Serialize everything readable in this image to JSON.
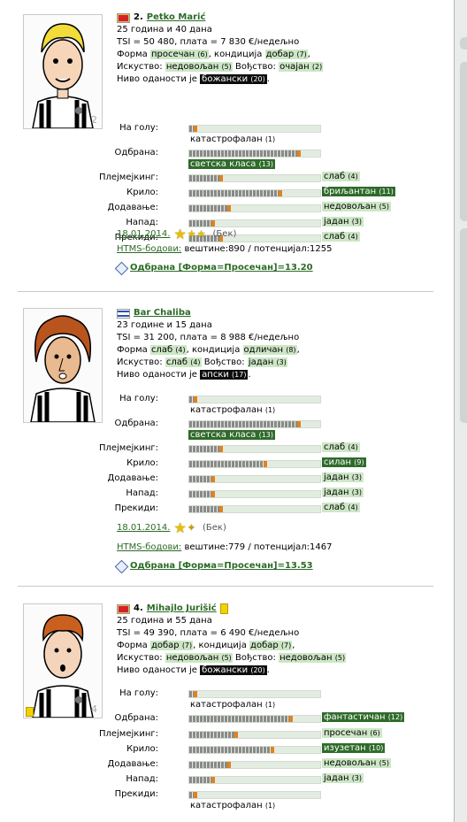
{
  "players": [
    {
      "number": "2.",
      "name": "Petko Marić",
      "age": "25 година и 40 дана",
      "tsi_line": "TSI = 50 480, плата = 7 830 €/недељно",
      "form_label": "Форма",
      "form_value": "просечан",
      "form_level": "(6)",
      "cond_label": ", кондиција",
      "cond_value": "добар",
      "cond_level": "(7)",
      "exp_label": "Искуство:",
      "exp_value": "недовољан",
      "exp_level": "(5)",
      "lead_label": "Вођство:",
      "lead_value": "очајан",
      "lead_level": "(2)",
      "loyal_label": "Ниво оданости је",
      "loyal_value": "божански",
      "loyal_level": "(20)",
      "shirt_number": "2",
      "skills": [
        {
          "label": "На голу:",
          "value": "катастрофалан",
          "level": "(1)",
          "pct": 0.06,
          "below": true
        },
        {
          "label": "Одбрана:",
          "value": "светска класа",
          "level": "(13)",
          "pct": 0.86,
          "below": true
        },
        {
          "label": "Плејмејкинг:",
          "value": "слаб",
          "level": "(4)",
          "pct": 0.26
        },
        {
          "label": "Крило:",
          "value": "бриљантан",
          "level": "(11)",
          "pct": 0.72
        },
        {
          "label": "Додавање:",
          "value": "недовољан",
          "level": "(5)",
          "pct": 0.32
        },
        {
          "label": "Напад:",
          "value": "јадан",
          "level": "(3)",
          "pct": 0.2
        },
        {
          "label": "Прекиди:",
          "value": "слаб",
          "level": "(4)",
          "pct": 0.26
        }
      ],
      "date": "18.01.2014.",
      "position": "(Бек)",
      "htms_label": "HTMS-бодови:",
      "htms_value": "вештине:890 / потенцијал:1255",
      "form_link": "Одбрана [Форма=Просечан]=13.20"
    },
    {
      "number": "",
      "name": "Bar Chaliba",
      "age": "23 године и 15 дана",
      "tsi_line": "TSI = 31 200, плата = 8 988 €/недељно",
      "form_label": "Форма",
      "form_value": "слаб",
      "form_level": "(4)",
      "cond_label": ", кондиција",
      "cond_value": "одличан",
      "cond_level": "(8)",
      "exp_label": "Искуство:",
      "exp_value": "слаб",
      "exp_level": "(4)",
      "lead_label": "Вођство:",
      "lead_value": "јадан",
      "lead_level": "(3)",
      "loyal_label": "Ниво оданости је",
      "loyal_value": "апски",
      "loyal_level": "(17)",
      "shirt_number": "",
      "skills": [
        {
          "label": "На голу:",
          "value": "катастрофалан",
          "level": "(1)",
          "pct": 0.06,
          "below": true
        },
        {
          "label": "Одбрана:",
          "value": "светска класа",
          "level": "(13)",
          "pct": 0.86,
          "below": true
        },
        {
          "label": "Плејмејкинг:",
          "value": "слаб",
          "level": "(4)",
          "pct": 0.26
        },
        {
          "label": "Крило:",
          "value": "силан",
          "level": "(9)",
          "pct": 0.6
        },
        {
          "label": "Додавање:",
          "value": "јадан",
          "level": "(3)",
          "pct": 0.2
        },
        {
          "label": "Напад:",
          "value": "јадан",
          "level": "(3)",
          "pct": 0.2
        },
        {
          "label": "Прекиди:",
          "value": "слаб",
          "level": "(4)",
          "pct": 0.26
        }
      ],
      "date": "18.01.2014.",
      "position": "(Бек)",
      "htms_label": "HTMS-бодови:",
      "htms_value": "вештине:779 / потенцијал:1467",
      "form_link": "Одбрана [Форма=Просечан]=13.53"
    },
    {
      "number": "4.",
      "name": "Mihajlo Jurišić",
      "age": "25 година и 55 дана",
      "tsi_line": "TSI = 49 390, плата = 6 490 €/недељно",
      "form_label": "Форма",
      "form_value": "добар",
      "form_level": "(7)",
      "cond_label": ", кондиција",
      "cond_value": "добар",
      "cond_level": "(7)",
      "exp_label": "Искуство:",
      "exp_value": "недовољан",
      "exp_level": "(5)",
      "lead_label": "Вођство:",
      "lead_value": "недовољан",
      "lead_level": "(5)",
      "loyal_label": "Ниво оданости је",
      "loyal_value": "божански",
      "loyal_level": "(20)",
      "shirt_number": "4",
      "skills": [
        {
          "label": "На голу:",
          "value": "катастрофалан",
          "level": "(1)",
          "pct": 0.06,
          "below": true
        },
        {
          "label": "Одбрана:",
          "value": "фантастичан",
          "level": "(12)",
          "pct": 0.8
        },
        {
          "label": "Плејмејкинг:",
          "value": "просечан",
          "level": "(6)",
          "pct": 0.38
        },
        {
          "label": "Крило:",
          "value": "изузетан",
          "level": "(10)",
          "pct": 0.66
        },
        {
          "label": "Додавање:",
          "value": "недовољан",
          "level": "(5)",
          "pct": 0.32
        },
        {
          "label": "Напад:",
          "value": "јадан",
          "level": "(3)",
          "pct": 0.2
        },
        {
          "label": "Прекиди:",
          "value": "катастрофалан",
          "level": "(1)",
          "pct": 0.06,
          "below": true
        }
      ]
    }
  ]
}
